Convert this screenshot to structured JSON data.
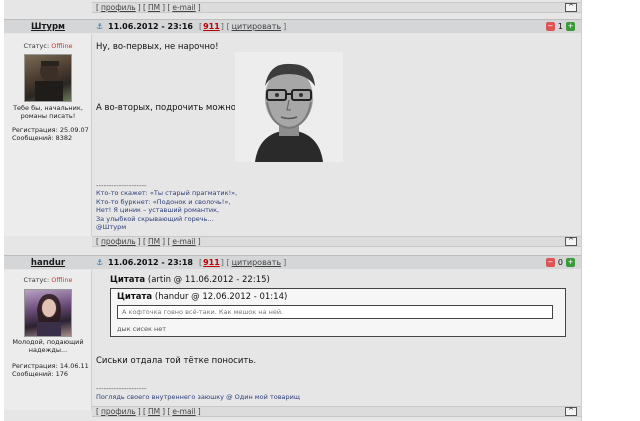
{
  "top_bar": {
    "profile": "профиль",
    "pm": "ПМ",
    "email": "e-mail",
    "up": "^"
  },
  "posts": [
    {
      "nick": "Штурм",
      "status_label": "Статус:",
      "status_value": "Offline",
      "motto": "Тебе бы, начальник, романы писать!",
      "reg_label": "Регистрация:",
      "reg_date": "25.09.07",
      "msgs_label": "Сообщений:",
      "msgs_count": "8382",
      "date": "11.06.2012 - 23:16",
      "post_num": "911",
      "quote_label": "цитировать",
      "rating_minus": "−",
      "rating_value": "1",
      "rating_plus": "+",
      "text1": "Ну, во-первых, не нарочно!",
      "text2": "А во-вторых, подрочить можно!",
      "sig_sep": "--------------------",
      "sig_lines": [
        "Кто-то скажет: «Ты старый прагматик!»,",
        "Кто-то буркнет: «Подонок и сволочь!»,",
        "Нет! Я циник – уставший романтик,",
        "За улыбкой скрывающий горечь…",
        "@Штурм"
      ],
      "links": {
        "profile": "профиль",
        "pm": "ПМ",
        "email": "e-mail",
        "up": "^"
      }
    },
    {
      "nick": "handur",
      "status_label": "Статус:",
      "status_value": "Offline",
      "motto": "Молодой, подающий надежды...",
      "reg_label": "Регистрация:",
      "reg_date": "14.06.11",
      "msgs_label": "Сообщений:",
      "msgs_count": "176",
      "date": "11.06.2012 - 23:18",
      "post_num": "911",
      "quote_label": "цитировать",
      "rating_minus": "−",
      "rating_value": "0",
      "rating_plus": "+",
      "quote_outer": {
        "title": "Цитата",
        "meta": "(artin @ 11.06.2012 - 22:15)"
      },
      "quote_inner": {
        "title": "Цитата",
        "meta": "(handur @ 12.06.2012 - 01:14)",
        "text": "А кофточка говно всё-таки. Как мешок на ней."
      },
      "quote_after": "дык сисек нет",
      "text1": "Сиськи отдала той тётке поносить.",
      "sig_sep": "--------------------",
      "sig_text": "Поглядь своего внутреннего заюшку @ Один мой товарищ",
      "links": {
        "profile": "профиль",
        "pm": "ПМ",
        "email": "e-mail",
        "up": "^"
      }
    }
  ]
}
